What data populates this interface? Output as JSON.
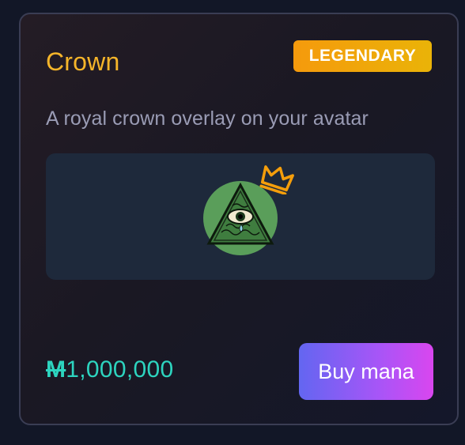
{
  "item": {
    "title": "Crown",
    "rarity": "LEGENDARY",
    "description": "A royal crown overlay on your avatar",
    "price_symbol": "M",
    "price_amount": "1,000,000",
    "buy_label": "Buy mana"
  },
  "colors": {
    "title": "#f5b52a",
    "rarity_badge": "#f59e0b",
    "price": "#2dd4bf",
    "buy_button_start": "#6366f1",
    "buy_button_end": "#d946ef",
    "crown": "#f59e0b",
    "avatar_bg": "#5a9e5a"
  },
  "icons": {
    "avatar": "illuminati-eye-avatar",
    "overlay": "crown-icon"
  }
}
